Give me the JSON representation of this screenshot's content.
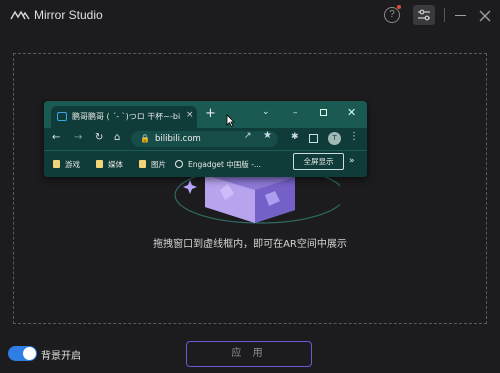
{
  "app": {
    "title": "Mirror Studio",
    "help_glyph": "?",
    "accent_color": "#6c57d9",
    "toggle_color": "#2f7ee6"
  },
  "dropzone": {
    "hint": "拖拽窗口到虚线框内，即可在AR空间中展示"
  },
  "browser": {
    "tab_title": "鹏哥鹏哥 ( ´- `)つロ 干杯~-bi",
    "tab_close": "×",
    "new_tab": "+",
    "url": "bilibili.com",
    "avatar_letter": "T",
    "bookmarks": [
      "游戏",
      "媒体",
      "图片",
      "Engadget 中国版 -..."
    ],
    "fullscreen_label": "全屏显示",
    "more": "»"
  },
  "footer": {
    "toggle_label": "背景开启",
    "toggle_on": true,
    "apply_label": "应 用"
  }
}
